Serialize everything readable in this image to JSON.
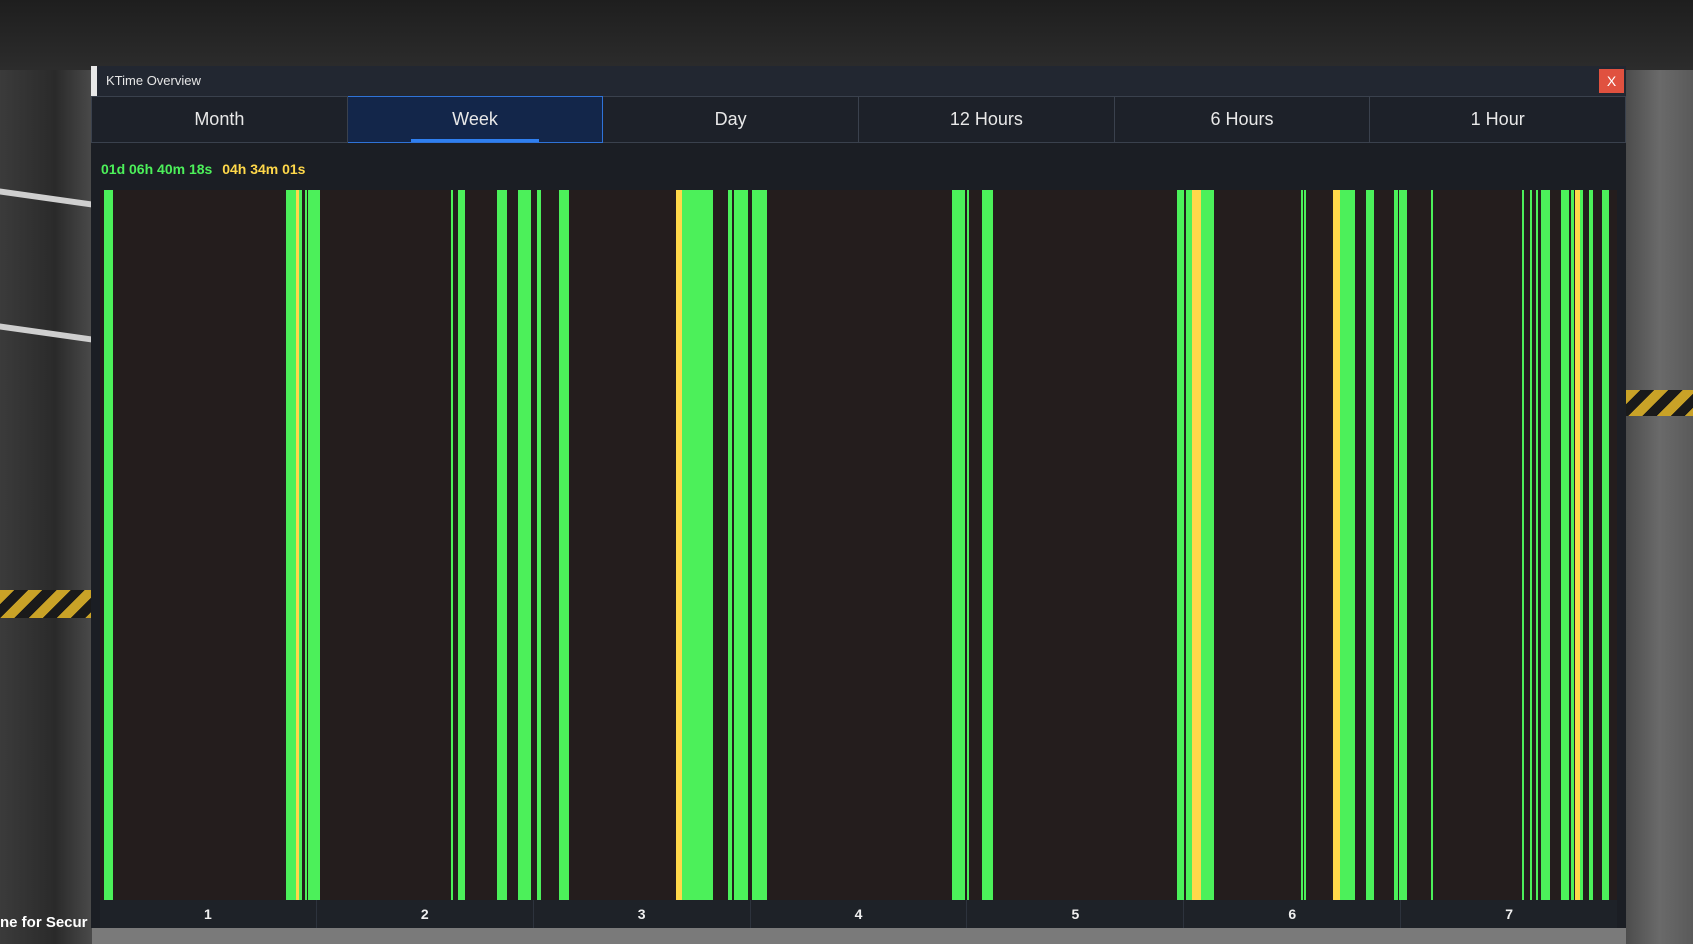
{
  "background": {
    "caption": "ne for Secur"
  },
  "window": {
    "title": "KTime Overview",
    "close_label": "X"
  },
  "tabs": [
    {
      "label": "Month",
      "active": false
    },
    {
      "label": "Week",
      "active": true
    },
    {
      "label": "Day",
      "active": false
    },
    {
      "label": "12 Hours",
      "active": false
    },
    {
      "label": "6 Hours",
      "active": false
    },
    {
      "label": "1 Hour",
      "active": false
    }
  ],
  "summary": {
    "green_time": "01d 06h 40m 18s",
    "yellow_time": "04h 34m 01s"
  },
  "colors": {
    "active": "#4cf05a",
    "idle": "#ffd84a",
    "none": "#241d1d",
    "accent": "#2f7ff0",
    "close": "#e0513f"
  },
  "chart_data": {
    "type": "bar",
    "x_unit": "day",
    "xlim": [
      0.5,
      7.5
    ],
    "categories": [
      "1",
      "2",
      "3",
      "4",
      "5",
      "6",
      "7"
    ],
    "segments": [
      {
        "start": 0.52,
        "end": 0.56,
        "state": "active"
      },
      {
        "start": 1.36,
        "end": 1.405,
        "state": "active"
      },
      {
        "start": 1.405,
        "end": 1.42,
        "state": "idle"
      },
      {
        "start": 1.42,
        "end": 1.43,
        "state": "active"
      },
      {
        "start": 1.445,
        "end": 1.455,
        "state": "active"
      },
      {
        "start": 1.46,
        "end": 1.515,
        "state": "active"
      },
      {
        "start": 2.12,
        "end": 2.13,
        "state": "active"
      },
      {
        "start": 2.15,
        "end": 2.185,
        "state": "active"
      },
      {
        "start": 2.33,
        "end": 2.38,
        "state": "active"
      },
      {
        "start": 2.43,
        "end": 2.49,
        "state": "active"
      },
      {
        "start": 2.515,
        "end": 2.535,
        "state": "active"
      },
      {
        "start": 2.62,
        "end": 2.665,
        "state": "active"
      },
      {
        "start": 3.16,
        "end": 3.185,
        "state": "idle"
      },
      {
        "start": 3.185,
        "end": 3.33,
        "state": "active"
      },
      {
        "start": 3.4,
        "end": 3.415,
        "state": "active"
      },
      {
        "start": 3.425,
        "end": 3.49,
        "state": "active"
      },
      {
        "start": 3.51,
        "end": 3.58,
        "state": "active"
      },
      {
        "start": 4.43,
        "end": 4.49,
        "state": "active"
      },
      {
        "start": 4.5,
        "end": 4.505,
        "state": "active"
      },
      {
        "start": 4.57,
        "end": 4.62,
        "state": "active"
      },
      {
        "start": 5.47,
        "end": 5.5,
        "state": "active"
      },
      {
        "start": 5.51,
        "end": 5.54,
        "state": "active"
      },
      {
        "start": 5.54,
        "end": 5.58,
        "state": "idle"
      },
      {
        "start": 5.58,
        "end": 5.64,
        "state": "active"
      },
      {
        "start": 6.04,
        "end": 6.048,
        "state": "active"
      },
      {
        "start": 6.055,
        "end": 6.062,
        "state": "active"
      },
      {
        "start": 6.19,
        "end": 6.22,
        "state": "idle"
      },
      {
        "start": 6.22,
        "end": 6.29,
        "state": "active"
      },
      {
        "start": 6.34,
        "end": 6.38,
        "state": "active"
      },
      {
        "start": 6.47,
        "end": 6.49,
        "state": "active"
      },
      {
        "start": 6.495,
        "end": 6.53,
        "state": "active"
      },
      {
        "start": 6.64,
        "end": 6.648,
        "state": "active"
      },
      {
        "start": 7.06,
        "end": 7.066,
        "state": "active"
      },
      {
        "start": 7.1,
        "end": 7.106,
        "state": "active"
      },
      {
        "start": 7.125,
        "end": 7.133,
        "state": "active"
      },
      {
        "start": 7.15,
        "end": 7.19,
        "state": "active"
      },
      {
        "start": 7.24,
        "end": 7.28,
        "state": "active"
      },
      {
        "start": 7.29,
        "end": 7.3,
        "state": "active"
      },
      {
        "start": 7.305,
        "end": 7.33,
        "state": "idle"
      },
      {
        "start": 7.33,
        "end": 7.345,
        "state": "active"
      },
      {
        "start": 7.37,
        "end": 7.39,
        "state": "active"
      },
      {
        "start": 7.43,
        "end": 7.465,
        "state": "active"
      }
    ]
  }
}
